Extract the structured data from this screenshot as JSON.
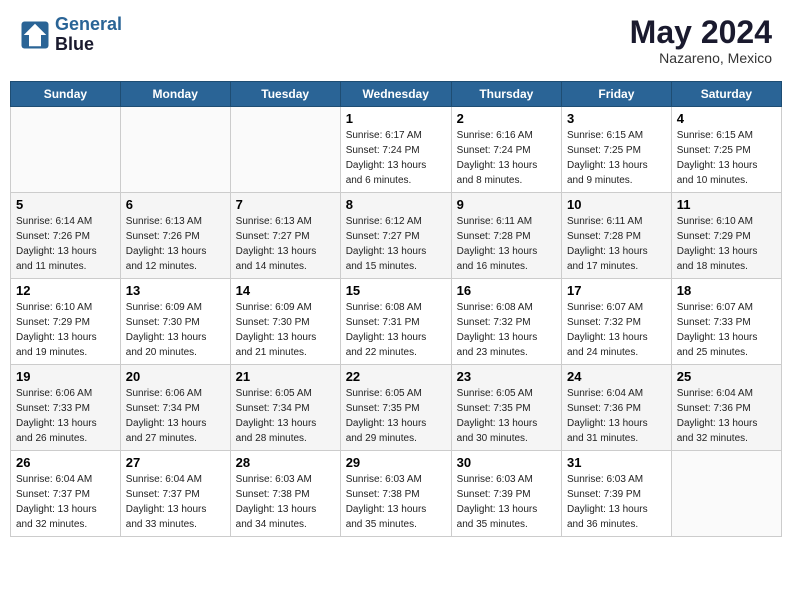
{
  "header": {
    "logo_line1": "General",
    "logo_line2": "Blue",
    "month": "May 2024",
    "location": "Nazareno, Mexico"
  },
  "weekdays": [
    "Sunday",
    "Monday",
    "Tuesday",
    "Wednesday",
    "Thursday",
    "Friday",
    "Saturday"
  ],
  "weeks": [
    [
      {
        "day": "",
        "info": ""
      },
      {
        "day": "",
        "info": ""
      },
      {
        "day": "",
        "info": ""
      },
      {
        "day": "1",
        "info": "Sunrise: 6:17 AM\nSunset: 7:24 PM\nDaylight: 13 hours\nand 6 minutes."
      },
      {
        "day": "2",
        "info": "Sunrise: 6:16 AM\nSunset: 7:24 PM\nDaylight: 13 hours\nand 8 minutes."
      },
      {
        "day": "3",
        "info": "Sunrise: 6:15 AM\nSunset: 7:25 PM\nDaylight: 13 hours\nand 9 minutes."
      },
      {
        "day": "4",
        "info": "Sunrise: 6:15 AM\nSunset: 7:25 PM\nDaylight: 13 hours\nand 10 minutes."
      }
    ],
    [
      {
        "day": "5",
        "info": "Sunrise: 6:14 AM\nSunset: 7:26 PM\nDaylight: 13 hours\nand 11 minutes."
      },
      {
        "day": "6",
        "info": "Sunrise: 6:13 AM\nSunset: 7:26 PM\nDaylight: 13 hours\nand 12 minutes."
      },
      {
        "day": "7",
        "info": "Sunrise: 6:13 AM\nSunset: 7:27 PM\nDaylight: 13 hours\nand 14 minutes."
      },
      {
        "day": "8",
        "info": "Sunrise: 6:12 AM\nSunset: 7:27 PM\nDaylight: 13 hours\nand 15 minutes."
      },
      {
        "day": "9",
        "info": "Sunrise: 6:11 AM\nSunset: 7:28 PM\nDaylight: 13 hours\nand 16 minutes."
      },
      {
        "day": "10",
        "info": "Sunrise: 6:11 AM\nSunset: 7:28 PM\nDaylight: 13 hours\nand 17 minutes."
      },
      {
        "day": "11",
        "info": "Sunrise: 6:10 AM\nSunset: 7:29 PM\nDaylight: 13 hours\nand 18 minutes."
      }
    ],
    [
      {
        "day": "12",
        "info": "Sunrise: 6:10 AM\nSunset: 7:29 PM\nDaylight: 13 hours\nand 19 minutes."
      },
      {
        "day": "13",
        "info": "Sunrise: 6:09 AM\nSunset: 7:30 PM\nDaylight: 13 hours\nand 20 minutes."
      },
      {
        "day": "14",
        "info": "Sunrise: 6:09 AM\nSunset: 7:30 PM\nDaylight: 13 hours\nand 21 minutes."
      },
      {
        "day": "15",
        "info": "Sunrise: 6:08 AM\nSunset: 7:31 PM\nDaylight: 13 hours\nand 22 minutes."
      },
      {
        "day": "16",
        "info": "Sunrise: 6:08 AM\nSunset: 7:32 PM\nDaylight: 13 hours\nand 23 minutes."
      },
      {
        "day": "17",
        "info": "Sunrise: 6:07 AM\nSunset: 7:32 PM\nDaylight: 13 hours\nand 24 minutes."
      },
      {
        "day": "18",
        "info": "Sunrise: 6:07 AM\nSunset: 7:33 PM\nDaylight: 13 hours\nand 25 minutes."
      }
    ],
    [
      {
        "day": "19",
        "info": "Sunrise: 6:06 AM\nSunset: 7:33 PM\nDaylight: 13 hours\nand 26 minutes."
      },
      {
        "day": "20",
        "info": "Sunrise: 6:06 AM\nSunset: 7:34 PM\nDaylight: 13 hours\nand 27 minutes."
      },
      {
        "day": "21",
        "info": "Sunrise: 6:05 AM\nSunset: 7:34 PM\nDaylight: 13 hours\nand 28 minutes."
      },
      {
        "day": "22",
        "info": "Sunrise: 6:05 AM\nSunset: 7:35 PM\nDaylight: 13 hours\nand 29 minutes."
      },
      {
        "day": "23",
        "info": "Sunrise: 6:05 AM\nSunset: 7:35 PM\nDaylight: 13 hours\nand 30 minutes."
      },
      {
        "day": "24",
        "info": "Sunrise: 6:04 AM\nSunset: 7:36 PM\nDaylight: 13 hours\nand 31 minutes."
      },
      {
        "day": "25",
        "info": "Sunrise: 6:04 AM\nSunset: 7:36 PM\nDaylight: 13 hours\nand 32 minutes."
      }
    ],
    [
      {
        "day": "26",
        "info": "Sunrise: 6:04 AM\nSunset: 7:37 PM\nDaylight: 13 hours\nand 32 minutes."
      },
      {
        "day": "27",
        "info": "Sunrise: 6:04 AM\nSunset: 7:37 PM\nDaylight: 13 hours\nand 33 minutes."
      },
      {
        "day": "28",
        "info": "Sunrise: 6:03 AM\nSunset: 7:38 PM\nDaylight: 13 hours\nand 34 minutes."
      },
      {
        "day": "29",
        "info": "Sunrise: 6:03 AM\nSunset: 7:38 PM\nDaylight: 13 hours\nand 35 minutes."
      },
      {
        "day": "30",
        "info": "Sunrise: 6:03 AM\nSunset: 7:39 PM\nDaylight: 13 hours\nand 35 minutes."
      },
      {
        "day": "31",
        "info": "Sunrise: 6:03 AM\nSunset: 7:39 PM\nDaylight: 13 hours\nand 36 minutes."
      },
      {
        "day": "",
        "info": ""
      }
    ]
  ]
}
